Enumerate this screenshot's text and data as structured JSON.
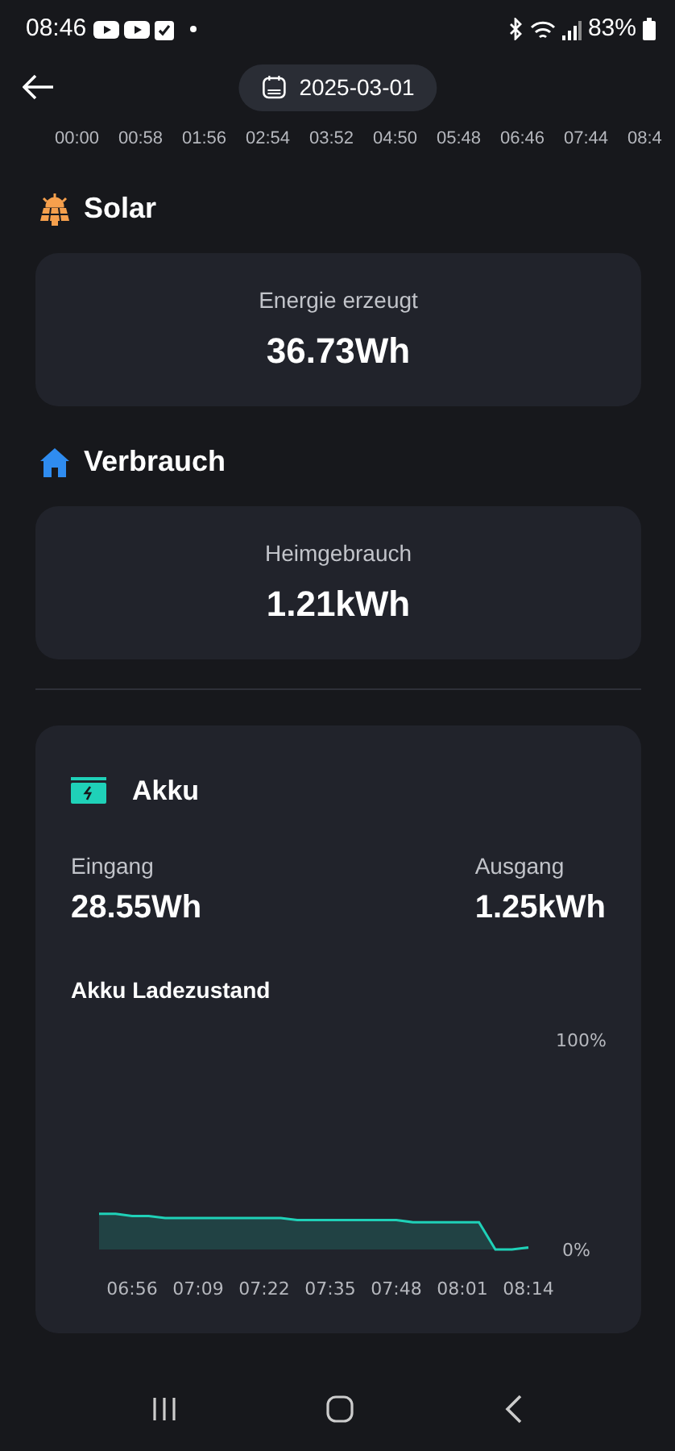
{
  "status_bar": {
    "time": "08:46",
    "battery": "83%"
  },
  "header": {
    "date": "2025-03-01"
  },
  "timeline": [
    "00:00",
    "00:58",
    "01:56",
    "02:54",
    "03:52",
    "04:50",
    "05:48",
    "06:46",
    "07:44",
    "08:4"
  ],
  "solar": {
    "title": "Solar",
    "label": "Energie erzeugt",
    "value": "36.73Wh"
  },
  "consumption": {
    "title": "Verbrauch",
    "label": "Heimgebrauch",
    "value": "1.21kWh"
  },
  "battery": {
    "title": "Akku",
    "input_label": "Eingang",
    "input_value": "28.55Wh",
    "output_label": "Ausgang",
    "output_value": "1.25kWh",
    "chart_data": {
      "type": "area",
      "title": "Akku Ladezustand",
      "categories": [
        null,
        null,
        "06:56",
        null,
        null,
        null,
        "07:09",
        null,
        null,
        null,
        "07:22",
        null,
        null,
        null,
        "07:35",
        null,
        null,
        null,
        "07:48",
        null,
        null,
        null,
        "08:01",
        null,
        null,
        null,
        "08:14"
      ],
      "series": [
        {
          "color": "#1fd1b8",
          "values": [
            17,
            17,
            16,
            16,
            15,
            15,
            15,
            15,
            15,
            15,
            15,
            15,
            14,
            14,
            14,
            14,
            14,
            14,
            14,
            13,
            13,
            13,
            13,
            13,
            0,
            0,
            1
          ]
        }
      ],
      "ylim": [
        0,
        100
      ],
      "yticks": [
        {
          "value": 0,
          "label": "0%"
        },
        {
          "value": 100,
          "label": "100%"
        }
      ]
    }
  }
}
